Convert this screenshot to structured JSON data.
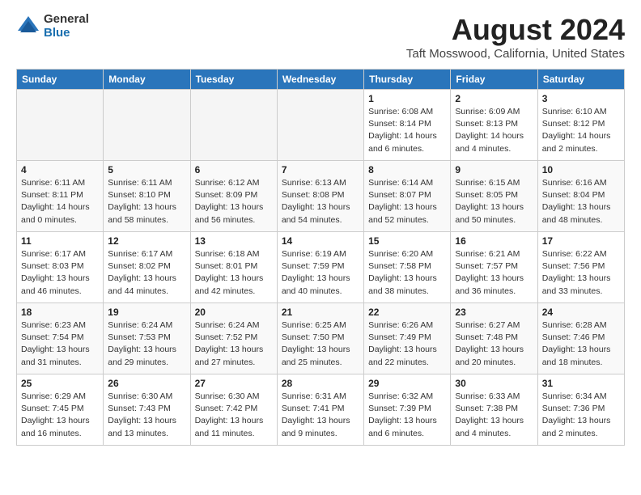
{
  "logo": {
    "general": "General",
    "blue": "Blue"
  },
  "title": "August 2024",
  "subtitle": "Taft Mosswood, California, United States",
  "days_of_week": [
    "Sunday",
    "Monday",
    "Tuesday",
    "Wednesday",
    "Thursday",
    "Friday",
    "Saturday"
  ],
  "weeks": [
    [
      {
        "day": "",
        "empty": true
      },
      {
        "day": "",
        "empty": true
      },
      {
        "day": "",
        "empty": true
      },
      {
        "day": "",
        "empty": true
      },
      {
        "day": "1",
        "sunrise": "6:08 AM",
        "sunset": "8:14 PM",
        "daylight": "14 hours and 6 minutes."
      },
      {
        "day": "2",
        "sunrise": "6:09 AM",
        "sunset": "8:13 PM",
        "daylight": "14 hours and 4 minutes."
      },
      {
        "day": "3",
        "sunrise": "6:10 AM",
        "sunset": "8:12 PM",
        "daylight": "14 hours and 2 minutes."
      }
    ],
    [
      {
        "day": "4",
        "sunrise": "6:11 AM",
        "sunset": "8:11 PM",
        "daylight": "14 hours and 0 minutes."
      },
      {
        "day": "5",
        "sunrise": "6:11 AM",
        "sunset": "8:10 PM",
        "daylight": "13 hours and 58 minutes."
      },
      {
        "day": "6",
        "sunrise": "6:12 AM",
        "sunset": "8:09 PM",
        "daylight": "13 hours and 56 minutes."
      },
      {
        "day": "7",
        "sunrise": "6:13 AM",
        "sunset": "8:08 PM",
        "daylight": "13 hours and 54 minutes."
      },
      {
        "day": "8",
        "sunrise": "6:14 AM",
        "sunset": "8:07 PM",
        "daylight": "13 hours and 52 minutes."
      },
      {
        "day": "9",
        "sunrise": "6:15 AM",
        "sunset": "8:05 PM",
        "daylight": "13 hours and 50 minutes."
      },
      {
        "day": "10",
        "sunrise": "6:16 AM",
        "sunset": "8:04 PM",
        "daylight": "13 hours and 48 minutes."
      }
    ],
    [
      {
        "day": "11",
        "sunrise": "6:17 AM",
        "sunset": "8:03 PM",
        "daylight": "13 hours and 46 minutes."
      },
      {
        "day": "12",
        "sunrise": "6:17 AM",
        "sunset": "8:02 PM",
        "daylight": "13 hours and 44 minutes."
      },
      {
        "day": "13",
        "sunrise": "6:18 AM",
        "sunset": "8:01 PM",
        "daylight": "13 hours and 42 minutes."
      },
      {
        "day": "14",
        "sunrise": "6:19 AM",
        "sunset": "7:59 PM",
        "daylight": "13 hours and 40 minutes."
      },
      {
        "day": "15",
        "sunrise": "6:20 AM",
        "sunset": "7:58 PM",
        "daylight": "13 hours and 38 minutes."
      },
      {
        "day": "16",
        "sunrise": "6:21 AM",
        "sunset": "7:57 PM",
        "daylight": "13 hours and 36 minutes."
      },
      {
        "day": "17",
        "sunrise": "6:22 AM",
        "sunset": "7:56 PM",
        "daylight": "13 hours and 33 minutes."
      }
    ],
    [
      {
        "day": "18",
        "sunrise": "6:23 AM",
        "sunset": "7:54 PM",
        "daylight": "13 hours and 31 minutes."
      },
      {
        "day": "19",
        "sunrise": "6:24 AM",
        "sunset": "7:53 PM",
        "daylight": "13 hours and 29 minutes."
      },
      {
        "day": "20",
        "sunrise": "6:24 AM",
        "sunset": "7:52 PM",
        "daylight": "13 hours and 27 minutes."
      },
      {
        "day": "21",
        "sunrise": "6:25 AM",
        "sunset": "7:50 PM",
        "daylight": "13 hours and 25 minutes."
      },
      {
        "day": "22",
        "sunrise": "6:26 AM",
        "sunset": "7:49 PM",
        "daylight": "13 hours and 22 minutes."
      },
      {
        "day": "23",
        "sunrise": "6:27 AM",
        "sunset": "7:48 PM",
        "daylight": "13 hours and 20 minutes."
      },
      {
        "day": "24",
        "sunrise": "6:28 AM",
        "sunset": "7:46 PM",
        "daylight": "13 hours and 18 minutes."
      }
    ],
    [
      {
        "day": "25",
        "sunrise": "6:29 AM",
        "sunset": "7:45 PM",
        "daylight": "13 hours and 16 minutes."
      },
      {
        "day": "26",
        "sunrise": "6:30 AM",
        "sunset": "7:43 PM",
        "daylight": "13 hours and 13 minutes."
      },
      {
        "day": "27",
        "sunrise": "6:30 AM",
        "sunset": "7:42 PM",
        "daylight": "13 hours and 11 minutes."
      },
      {
        "day": "28",
        "sunrise": "6:31 AM",
        "sunset": "7:41 PM",
        "daylight": "13 hours and 9 minutes."
      },
      {
        "day": "29",
        "sunrise": "6:32 AM",
        "sunset": "7:39 PM",
        "daylight": "13 hours and 6 minutes."
      },
      {
        "day": "30",
        "sunrise": "6:33 AM",
        "sunset": "7:38 PM",
        "daylight": "13 hours and 4 minutes."
      },
      {
        "day": "31",
        "sunrise": "6:34 AM",
        "sunset": "7:36 PM",
        "daylight": "13 hours and 2 minutes."
      }
    ]
  ]
}
